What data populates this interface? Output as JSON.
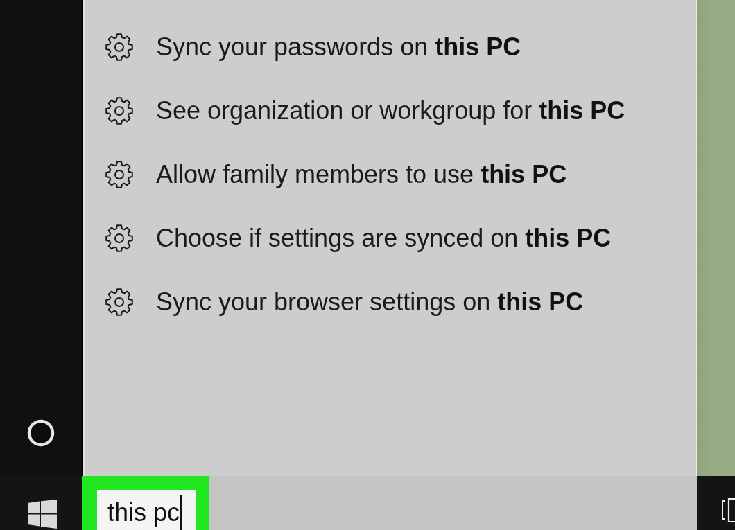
{
  "search_results": [
    {
      "label": "Sync your passwords on **this PC**"
    },
    {
      "label": "See organization or workgroup for **this PC**"
    },
    {
      "label": "Allow family members to use **this PC**"
    },
    {
      "label": "Choose if settings are synced on **this PC**"
    },
    {
      "label": "Sync your browser settings on **this PC**"
    }
  ],
  "taskbar": {
    "search_field": {
      "value": "this pc",
      "highlighted": true
    }
  }
}
